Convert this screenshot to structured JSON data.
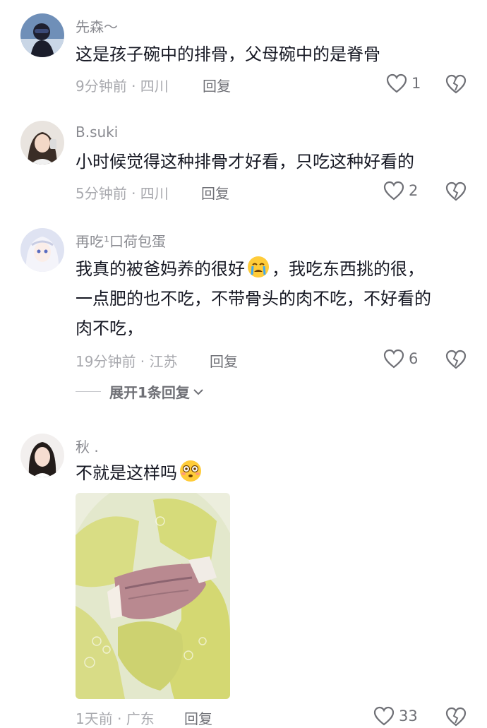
{
  "comments": [
    {
      "username": "先森～",
      "text": "这是孩子碗中的排骨，父母碗中的是脊骨",
      "time_location": "9分钟前 · 四川",
      "reply_label": "回复",
      "likes": "1",
      "avatar_icon": "avatar-person-dark-icon"
    },
    {
      "username": "B.suki",
      "text": "小时候觉得这种排骨才好看，只吃这种好看的",
      "time_location": "5分钟前 · 四川",
      "reply_label": "回复",
      "likes": "2",
      "avatar_icon": "avatar-woman-selfie-icon"
    },
    {
      "username": "再吃¹口荷包蛋",
      "text_parts": [
        "我真的被爸妈养的很好",
        "，我吃东西挑的很，",
        "一点肥的也不吃，不带骨头的肉不吃，不好看的",
        "肉不吃，"
      ],
      "time_location": "19分钟前 · 江苏",
      "reply_label": "回复",
      "likes": "6",
      "expand_label": "展开1条回复",
      "avatar_icon": "avatar-anime-girl-icon"
    },
    {
      "username": "秋 .",
      "text": "不就是这样吗",
      "time_location": "1天前 · 广东",
      "reply_label": "回复",
      "likes": "33",
      "avatar_icon": "avatar-woman-portrait-icon",
      "image": "soup-rib-photo"
    }
  ],
  "colors": {
    "text": "#161823",
    "secondary": "#8a8b91",
    "meta": "#a8a9ae"
  }
}
